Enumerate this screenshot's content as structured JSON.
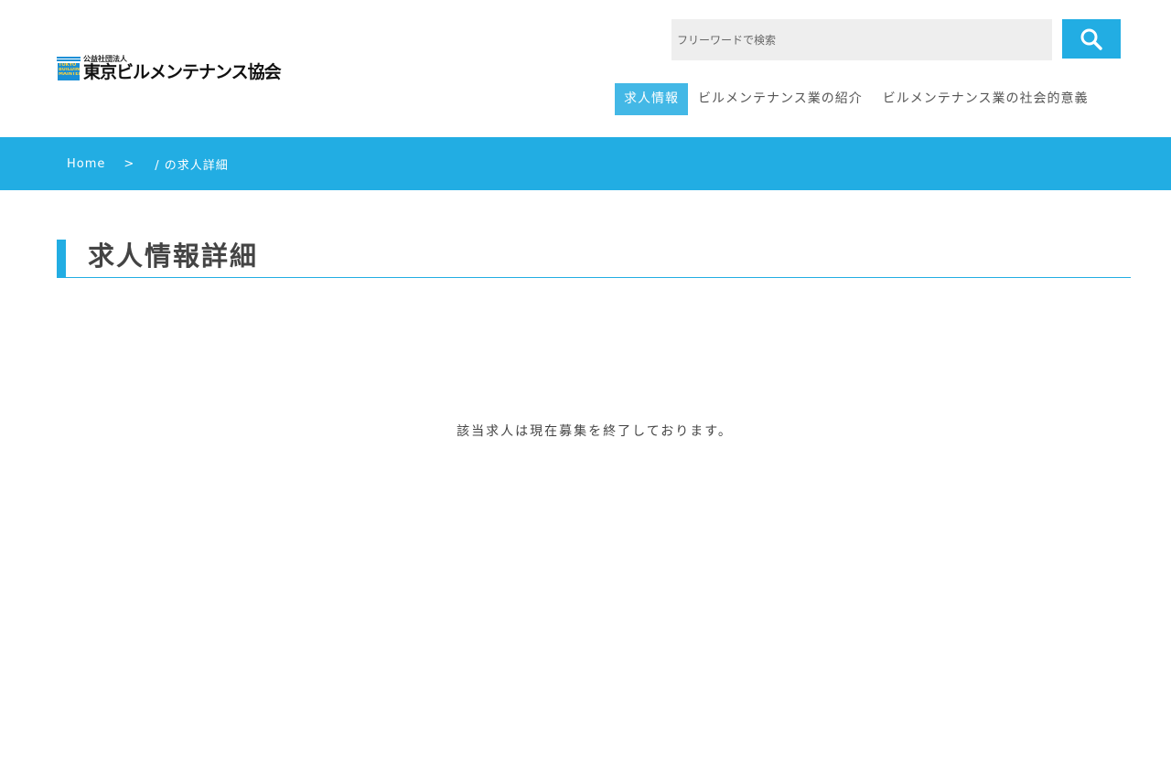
{
  "header": {
    "logo": {
      "subtitle": "公益社団法人",
      "name": "東京ビルメンテナンス協会",
      "mark_text": [
        "TOKYO",
        "BUILDING",
        "MAINTENANCE",
        "ASSOCIATION"
      ]
    },
    "search": {
      "placeholder": "フリーワードで検索"
    },
    "nav": [
      {
        "label": "求人情報",
        "active": true
      },
      {
        "label": "ビルメンテナンス業の紹介",
        "active": false
      },
      {
        "label": "ビルメンテナンス業の社会的意義",
        "active": false
      }
    ]
  },
  "breadcrumb": {
    "home": "Home",
    "separator": ">",
    "current": "/ の求人詳細"
  },
  "main": {
    "title": "求人情報詳細",
    "notice": "該当求人は現在募集を終了しております。"
  },
  "colors": {
    "accent": "#22ade3",
    "nav_active": "#43b8e6",
    "logo_blue": "#1a8fd6",
    "logo_yellow": "#ffd23c"
  },
  "icons": {
    "search": "search-icon"
  }
}
